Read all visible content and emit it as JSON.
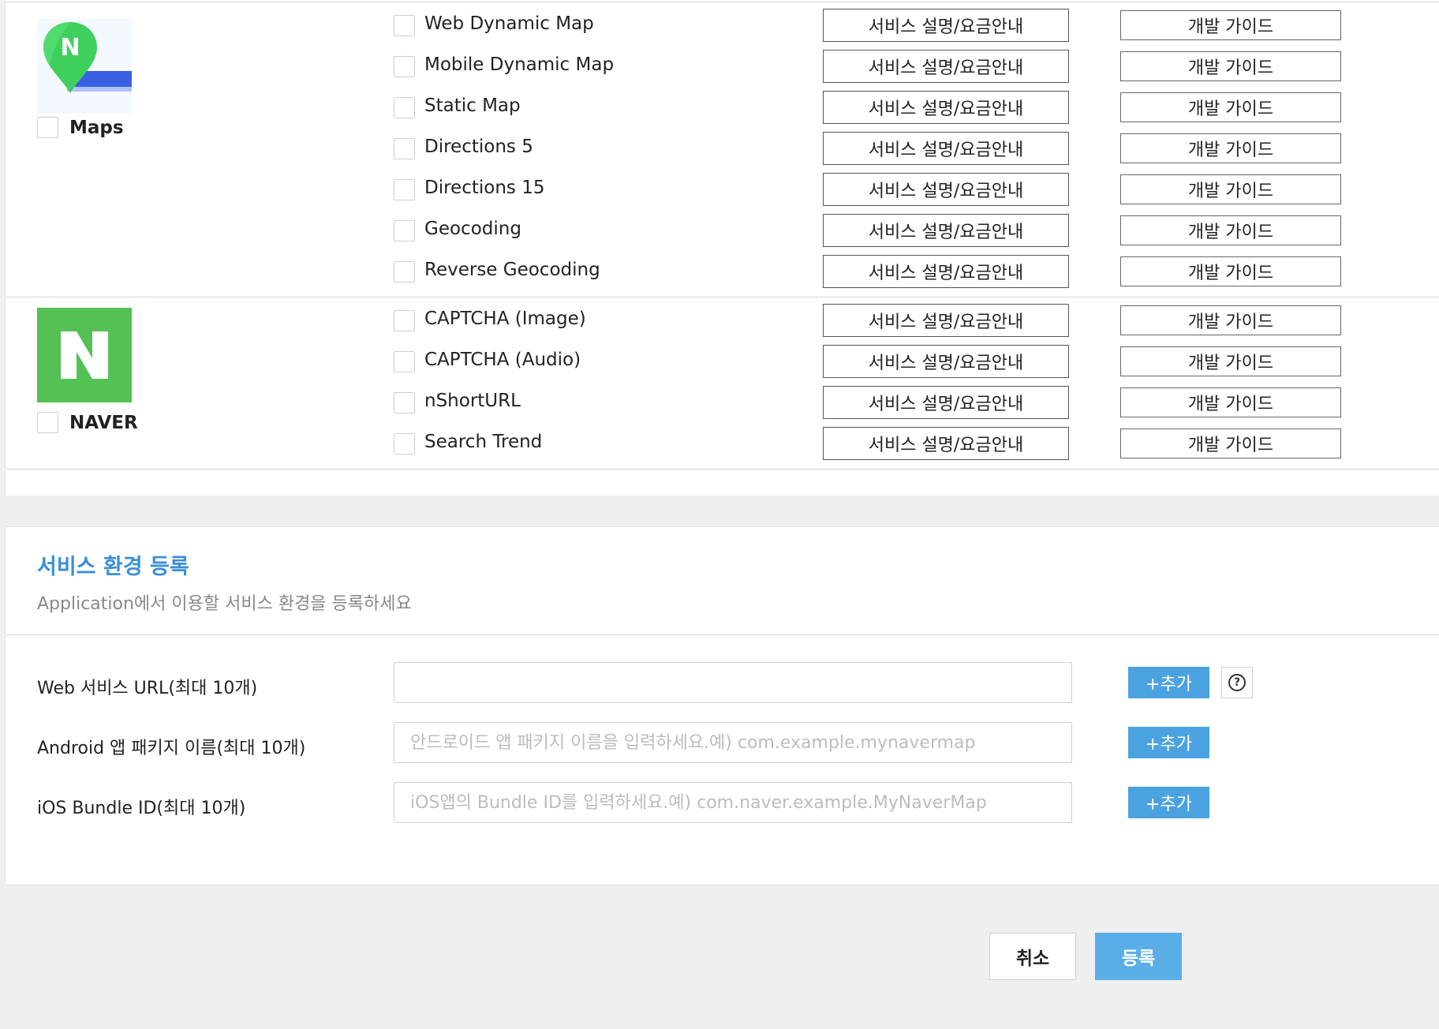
{
  "groups": {
    "maps": {
      "label": "Maps",
      "services": [
        {
          "name": "Web Dynamic Map",
          "desc_button": "서비스 설명/요금안내",
          "guide_button": "개발 가이드"
        },
        {
          "name": "Mobile Dynamic Map",
          "desc_button": "서비스 설명/요금안내",
          "guide_button": "개발 가이드"
        },
        {
          "name": "Static Map",
          "desc_button": "서비스 설명/요금안내",
          "guide_button": "개발 가이드"
        },
        {
          "name": "Directions 5",
          "desc_button": "서비스 설명/요금안내",
          "guide_button": "개발 가이드"
        },
        {
          "name": "Directions 15",
          "desc_button": "서비스 설명/요금안내",
          "guide_button": "개발 가이드"
        },
        {
          "name": "Geocoding",
          "desc_button": "서비스 설명/요금안내",
          "guide_button": "개발 가이드"
        },
        {
          "name": "Reverse Geocoding",
          "desc_button": "서비스 설명/요금안내",
          "guide_button": "개발 가이드"
        }
      ]
    },
    "naver": {
      "label": "NAVER",
      "services": [
        {
          "name": "CAPTCHA (Image)",
          "desc_button": "서비스 설명/요금안내",
          "guide_button": "개발 가이드"
        },
        {
          "name": "CAPTCHA (Audio)",
          "desc_button": "서비스 설명/요금안내",
          "guide_button": "개발 가이드"
        },
        {
          "name": "nShortURL",
          "desc_button": "서비스 설명/요금안내",
          "guide_button": "개발 가이드"
        },
        {
          "name": "Search Trend",
          "desc_button": "서비스 설명/요금안내",
          "guide_button": "개발 가이드"
        }
      ]
    }
  },
  "env": {
    "title": "서비스 환경 등록",
    "subtitle": "Application에서 이용할 서비스 환경을 등록하세요",
    "fields": [
      {
        "label": "Web 서비스 URL(최대 10개)",
        "value": "",
        "placeholder": "",
        "add_button": "+추가"
      },
      {
        "label": "Android 앱 패키지 이름(최대 10개)",
        "value": "",
        "placeholder": "안드로이드 앱 패키지 이름을 입력하세요.예) com.example.mynavermap",
        "add_button": "+추가"
      },
      {
        "label": "iOS Bundle ID(최대 10개)",
        "value": "",
        "placeholder": "iOS앱의 Bundle ID를 입력하세요.예) com.naver.example.MyNaverMap",
        "add_button": "+추가"
      }
    ],
    "help_icon": "question-circle-icon"
  },
  "footer": {
    "cancel_label": "취소",
    "submit_label": "등록"
  },
  "colors": {
    "accent_blue": "#4aa3e0",
    "title_blue": "#3a8ed6",
    "naver_green": "#53c153",
    "map_pin_green": "#3fcf5d",
    "map_route_blue": "#3a5fe0"
  }
}
